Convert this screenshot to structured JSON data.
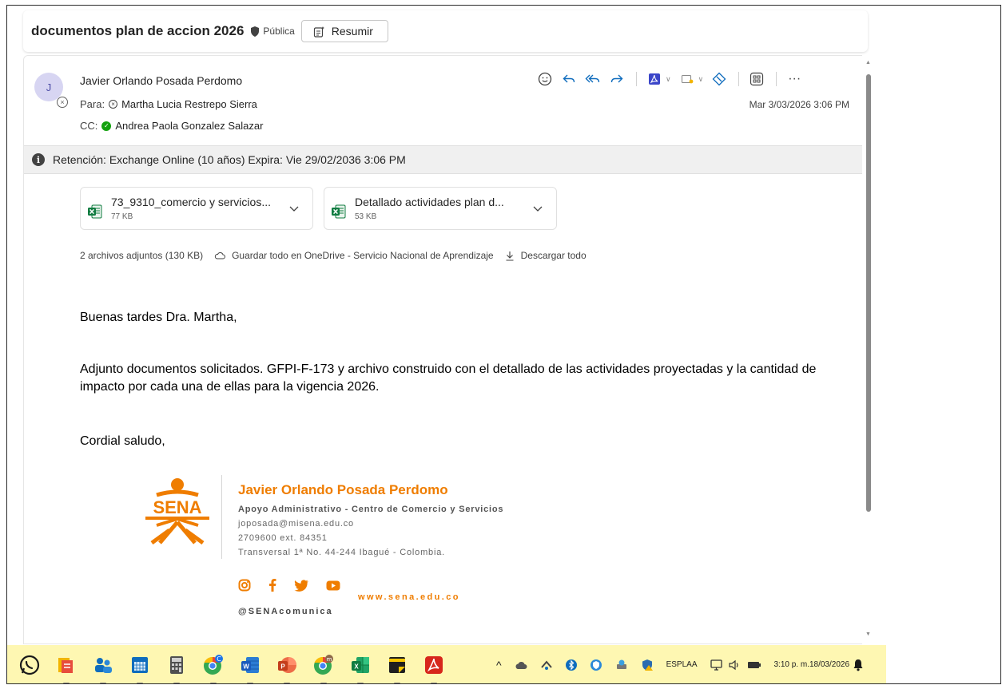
{
  "subject": {
    "title": "documentos plan de accion 2026",
    "visibility": "Pública",
    "summarize_label": "Resumir"
  },
  "message": {
    "avatar_initial": "J",
    "sender": "Javier Orlando Posada Perdomo",
    "to_label": "Para:",
    "to": "Martha Lucia Restrepo Sierra",
    "cc_label": "CC:",
    "cc": "Andrea Paola Gonzalez Salazar",
    "date": "Mar 3/03/2026 3:06 PM",
    "actions": [
      "emoji-icon",
      "reply-icon",
      "reply-all-icon",
      "forward-icon",
      "pdf-icon",
      "move-icon",
      "sensitivity-icon",
      "apps-icon",
      "more-icon"
    ],
    "more_label": "···"
  },
  "retention": {
    "text": "Retención: Exchange Online (10 años) Expira: Vie 29/02/2036 3:06 PM"
  },
  "attachments": {
    "items": [
      {
        "name": "73_9310_comercio y servicios...",
        "size": "77 KB"
      },
      {
        "name": "Detallado actividades plan d...",
        "size": "53 KB"
      }
    ],
    "summary": "2 archivos adjuntos (130 KB)",
    "save_onedrive": "Guardar todo en OneDrive - Servicio Nacional de Aprendizaje",
    "download_all": "Descargar todo"
  },
  "body": {
    "greeting": "Buenas tardes Dra. Martha,",
    "paragraph": "Adjunto documentos solicitados. GFPI-F-173  y archivo construido con el detallado de las actividades proyectadas y la cantidad de impacto por cada una de ellas para la vigencia 2026.",
    "closing": "Cordial saludo,"
  },
  "signature": {
    "logo_text": "SENA",
    "name": "Javier Orlando Posada Perdomo",
    "role": "Apoyo Administrativo - Centro de Comercio y Servicios",
    "email": "joposada@misena.edu.co",
    "phone": "2709600 ext. 84351",
    "address": "Transversal 1ª No. 44-244 Ibagué - Colombia.",
    "handle": "@SENAcomunica",
    "website": "www.sena.edu.co"
  },
  "taskbar": {
    "apps": [
      "whatsapp-icon",
      "file-explorer-icon",
      "people-app-icon",
      "calendar-app-icon",
      "calculator-icon",
      "chrome-icon",
      "word-icon",
      "powerpoint-icon",
      "chrome-profile-icon",
      "excel-icon",
      "sticky-notes-icon",
      "acrobat-icon"
    ],
    "tray_chevron": "^",
    "language": "ESP",
    "layout": "LAA",
    "time": "3:10 p. m.",
    "date": "18/03/2026"
  },
  "colors": {
    "accent": "#0f6cbd",
    "sena_orange": "#ef7d00",
    "taskbar": "#fef7b2",
    "excel_green": "#107c41"
  }
}
